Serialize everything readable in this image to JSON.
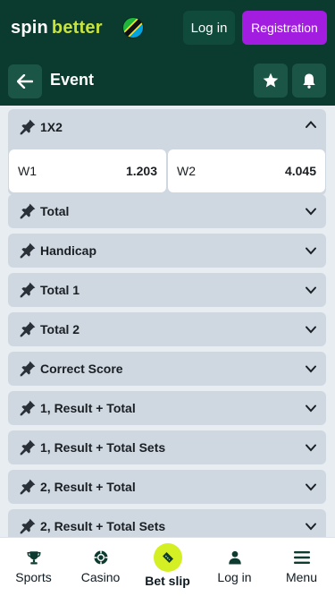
{
  "header": {
    "logo_spin": "spin",
    "logo_better": "better",
    "login_label": "Log in",
    "register_label": "Registration",
    "flag_icon": "tanzania-flag-icon"
  },
  "subheader": {
    "title": "Event",
    "back_icon": "arrow-left-icon",
    "favorite_icon": "star-icon",
    "notify_icon": "bell-icon"
  },
  "markets": [
    {
      "label": "1X2",
      "expanded": true,
      "odds": [
        {
          "name": "W1",
          "value": "1.203"
        },
        {
          "name": "W2",
          "value": "4.045"
        }
      ]
    },
    {
      "label": "Total",
      "expanded": false
    },
    {
      "label": "Handicap",
      "expanded": false
    },
    {
      "label": "Total 1",
      "expanded": false
    },
    {
      "label": "Total 2",
      "expanded": false
    },
    {
      "label": "Correct Score",
      "expanded": false
    },
    {
      "label": "1, Result + Total",
      "expanded": false
    },
    {
      "label": "1, Result + Total Sets",
      "expanded": false
    },
    {
      "label": "2, Result + Total",
      "expanded": false
    },
    {
      "label": "2, Result + Total Sets",
      "expanded": false
    }
  ],
  "bottom_nav": [
    {
      "label": "Sports",
      "icon": "trophy-icon"
    },
    {
      "label": "Casino",
      "icon": "casino-chip-icon"
    },
    {
      "label": "Bet slip",
      "icon": "ticket-icon"
    },
    {
      "label": "Log in",
      "icon": "user-icon"
    },
    {
      "label": "Menu",
      "icon": "menu-icon"
    }
  ],
  "colors": {
    "header_bg": "#0b3a2e",
    "register_bg": "#a21de0",
    "brand_accent": "#c8e43c",
    "market_bg": "#cfd7e0",
    "betslip_accent": "#d4f025"
  }
}
